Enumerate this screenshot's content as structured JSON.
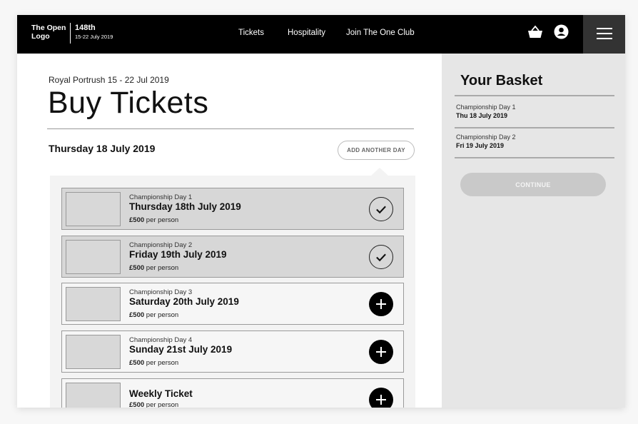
{
  "header": {
    "logo_text": "The Open Logo",
    "edition": "148th",
    "edition_dates": "15-22 July 2019",
    "nav": [
      {
        "label": "Tickets"
      },
      {
        "label": "Hospitality"
      },
      {
        "label": "Join The One Club"
      }
    ],
    "icons": [
      "basket-icon",
      "account-icon",
      "menu-icon"
    ]
  },
  "main": {
    "venue": "Royal Portrush 15 - 22 Jul 2019",
    "title": "Buy Tickets",
    "selected_date": "Thursday 18 July 2019",
    "add_day_label": "ADD ANOTHER DAY",
    "tickets": [
      {
        "label": "Championship Day 1",
        "date": "Thursday 18th July 2019",
        "price": "£500",
        "unit": " per person",
        "state": "selected"
      },
      {
        "label": "Championship Day 2",
        "date": "Friday 19th July 2019",
        "price": "£500",
        "unit": " per person",
        "state": "selected"
      },
      {
        "label": "Championship Day 3",
        "date": "Saturday 20th July 2019",
        "price": "£500",
        "unit": " per person",
        "state": "available"
      },
      {
        "label": "Championship Day 4",
        "date": "Sunday 21st July 2019",
        "price": "£500",
        "unit": " per person",
        "state": "available"
      },
      {
        "label": "",
        "date": "Weekly Ticket",
        "price": "£500",
        "unit": " per person",
        "state": "available"
      }
    ]
  },
  "basket": {
    "title": "Your Basket",
    "items": [
      {
        "label": "Championship Day 1",
        "date": "Thu 18 July 2019"
      },
      {
        "label": "Championship Day 2",
        "date": "Fri 19 July 2019"
      }
    ],
    "continue_label": "CONTINUE"
  },
  "colors": {
    "header_bg": "#000000",
    "menu_bg": "#333333",
    "selected_card": "#d7d7d7",
    "sidebar_bg": "#e6e6e6",
    "continue_disabled": "#c9c9c9"
  }
}
